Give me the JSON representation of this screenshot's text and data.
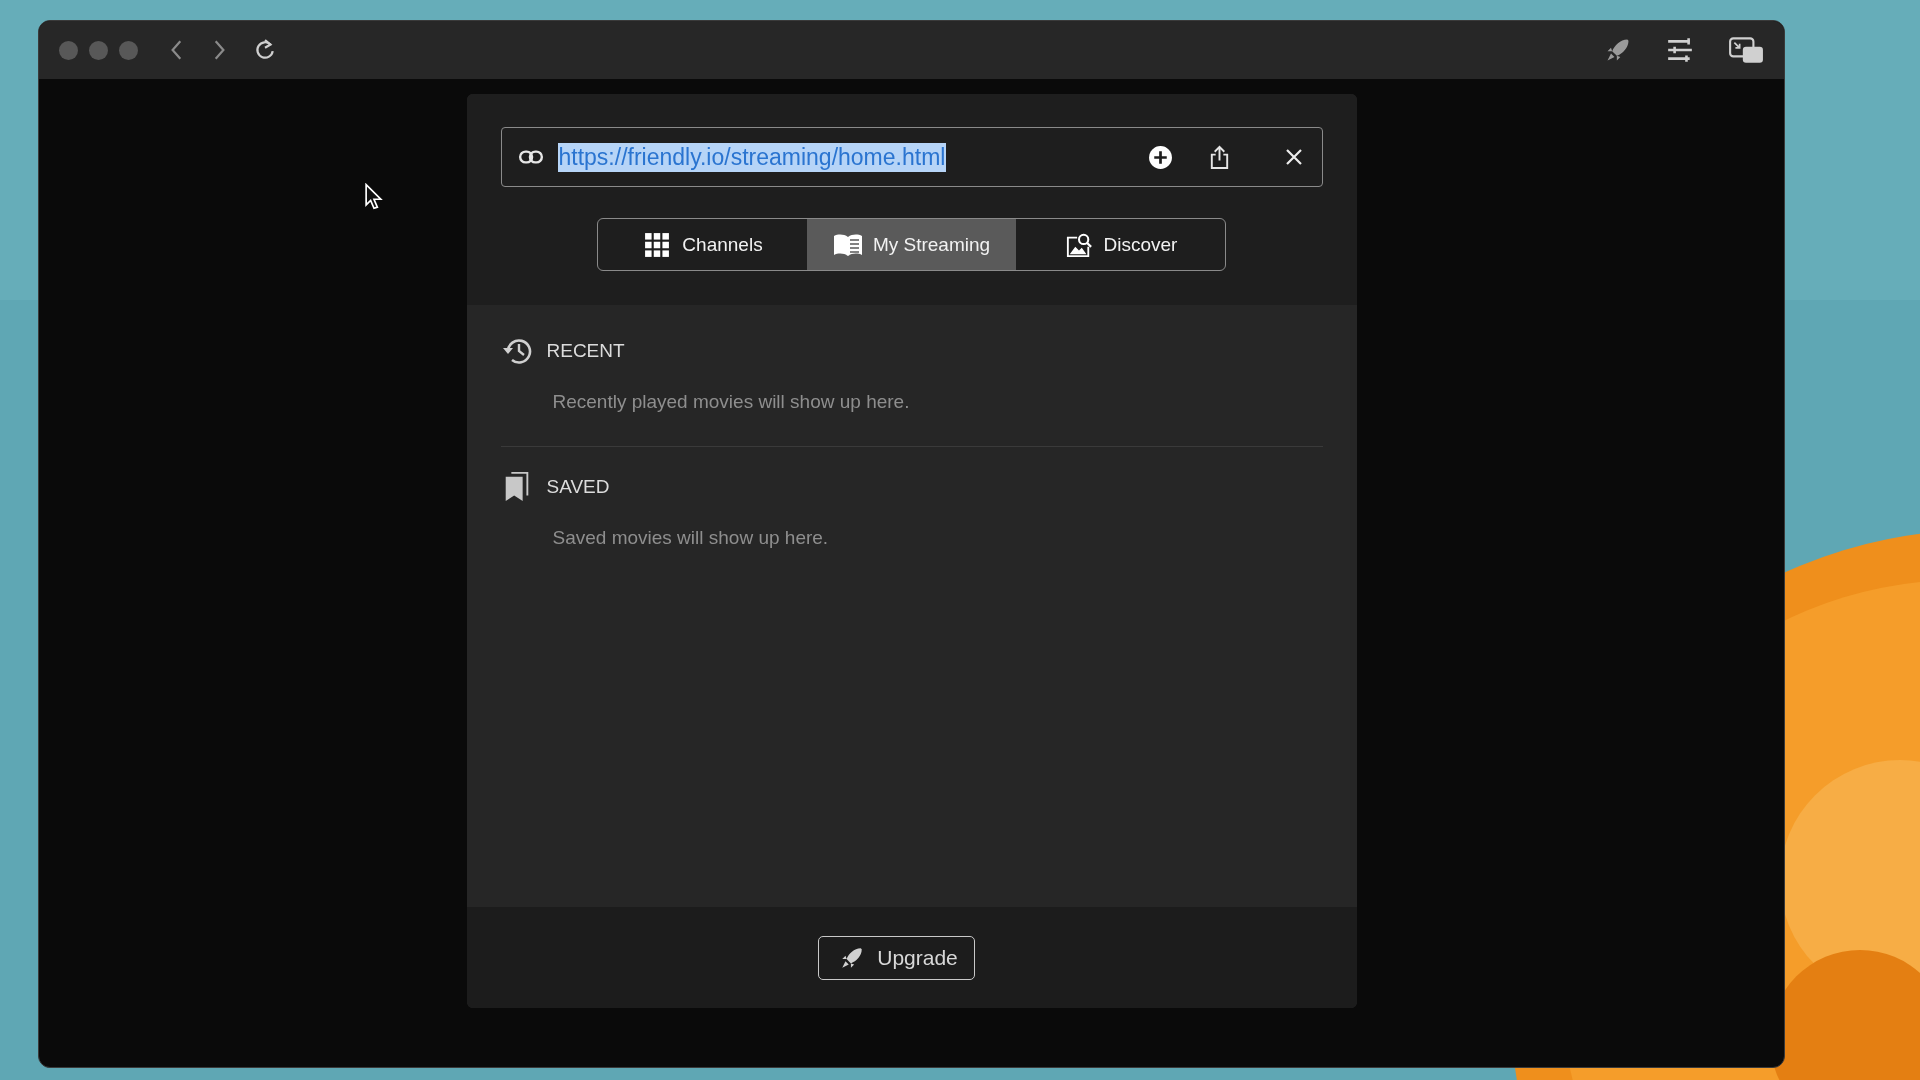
{
  "address_bar": {
    "value": "https://friendly.io/streaming/home.html",
    "text_selected": true
  },
  "tabs": [
    {
      "label": "Channels",
      "kind": "grid",
      "selected": false
    },
    {
      "label": "My Streaming",
      "kind": "book",
      "selected": true
    },
    {
      "label": "Discover",
      "kind": "image-search",
      "selected": false
    }
  ],
  "sections": [
    {
      "kind": "recent",
      "title": "RECENT",
      "message": "Recently played movies will show up here."
    },
    {
      "kind": "saved",
      "title": "SAVED",
      "message": "Saved movies will show up here."
    }
  ],
  "footer": {
    "button": "Upgrade"
  }
}
